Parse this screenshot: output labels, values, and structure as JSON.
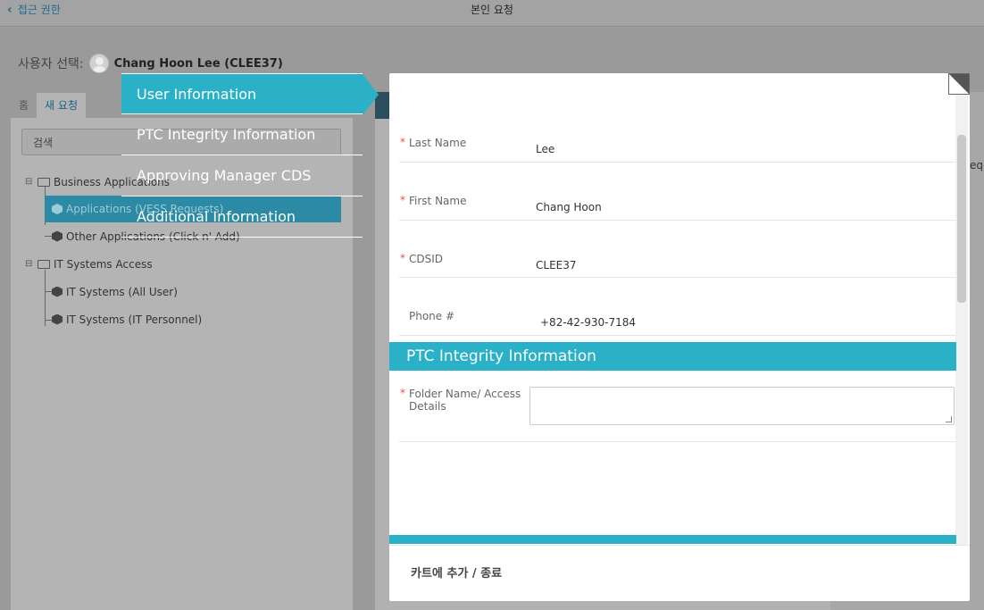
{
  "header": {
    "back_label": "접근 권한",
    "title": "본인 요청"
  },
  "user_select": {
    "label": "사용자 선택:",
    "name": "Chang Hoon Lee (CLEE37)"
  },
  "tabs": [
    {
      "label": "홈"
    },
    {
      "label": "새 요청"
    }
  ],
  "search": {
    "placeholder": "검색"
  },
  "tree": {
    "business_apps": "Business Applications",
    "applications_vess": "Applications (VESS Requests)",
    "other_apps": "Other Applications (Click n' Add)",
    "it_systems_access": "IT Systems Access",
    "it_all_user": "IT Systems (All User)",
    "it_personnel": "IT Systems (IT Personnel)"
  },
  "steps": [
    {
      "label": "User Information",
      "active": true
    },
    {
      "label": "PTC Integrity Information"
    },
    {
      "label": "Approving Manager CDS"
    },
    {
      "label": "Additional Information"
    }
  ],
  "form": {
    "fields": [
      {
        "label": "Last Name",
        "value": "Lee",
        "required": "*"
      },
      {
        "label": "First Name",
        "value": "Chang Hoon",
        "required": "*"
      },
      {
        "label": "CDSID",
        "value": "CLEE37",
        "required": "*"
      },
      {
        "label": "Phone #",
        "value": "+82-42-930-7184"
      }
    ],
    "section2_title": "PTC Integrity Information",
    "folder_label": "Folder Name/ Access Details",
    "folder_required": "*"
  },
  "footer": {
    "button_label": "카트에 추가 / 종료"
  },
  "right_fragment": "equ"
}
